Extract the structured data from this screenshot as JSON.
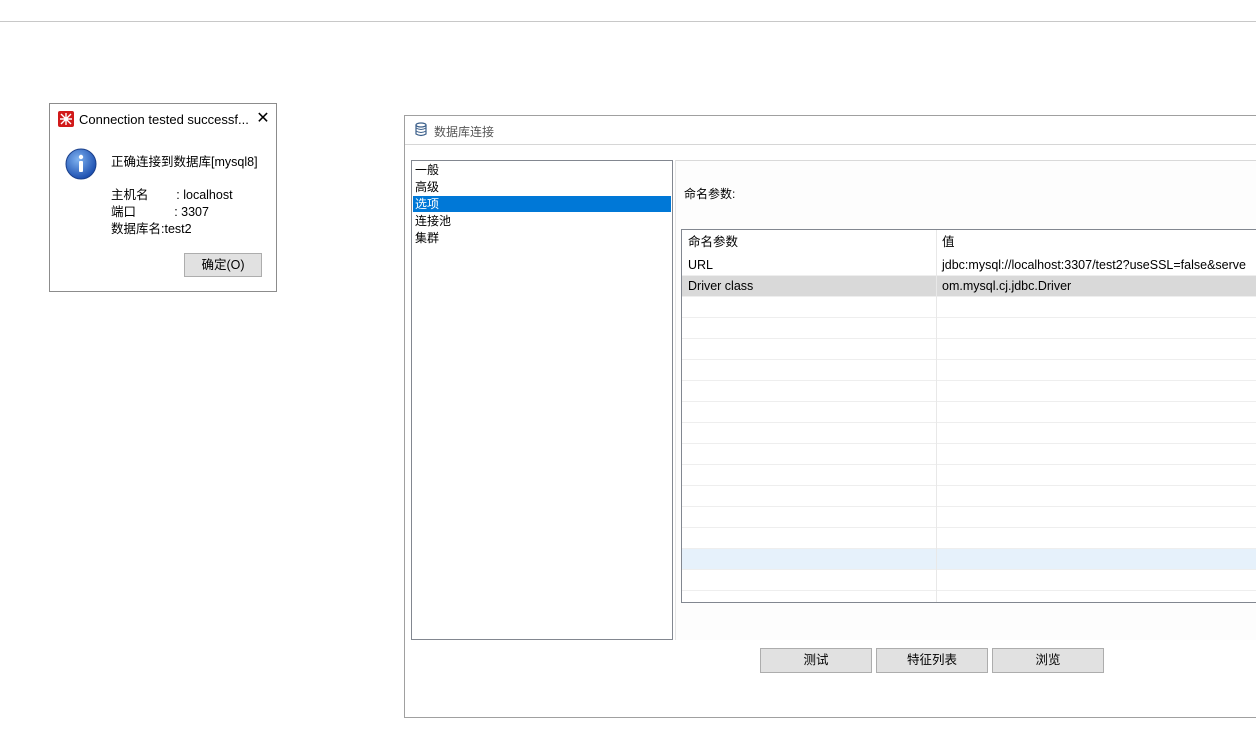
{
  "message_dialog": {
    "title": "Connection tested successf...",
    "close_symbol": "✕",
    "lines": [
      "正确连接到数据库[mysql8]",
      "主机名        : localhost",
      "端口           : 3307",
      "数据库名:test2"
    ],
    "ok_label": "确定(O)",
    "icons": [
      "app-logo-icon",
      "information-icon",
      "close-icon"
    ]
  },
  "window": {
    "title": "数据库连接",
    "icon": "database-icon",
    "nav_items": [
      "一般",
      "高级",
      "选项",
      "连接池",
      "集群"
    ],
    "selected_nav": "选项",
    "section_label": "命名参数:",
    "table": {
      "columns": [
        "命名参数",
        "值"
      ],
      "rows": [
        {
          "name": "URL",
          "value": "jdbc:mysql://localhost:3307/test2?useSSL=false&serve"
        },
        {
          "name": "Driver class",
          "value": "om.mysql.cj.jdbc.Driver"
        }
      ]
    },
    "buttons": [
      "测试",
      "特征列表",
      "浏览"
    ]
  },
  "colors": {
    "selection": "#0078d7",
    "selected_row": "#d9d9d9",
    "hover_row": "#e6f1fb",
    "app_icon": "#d11a1a"
  }
}
